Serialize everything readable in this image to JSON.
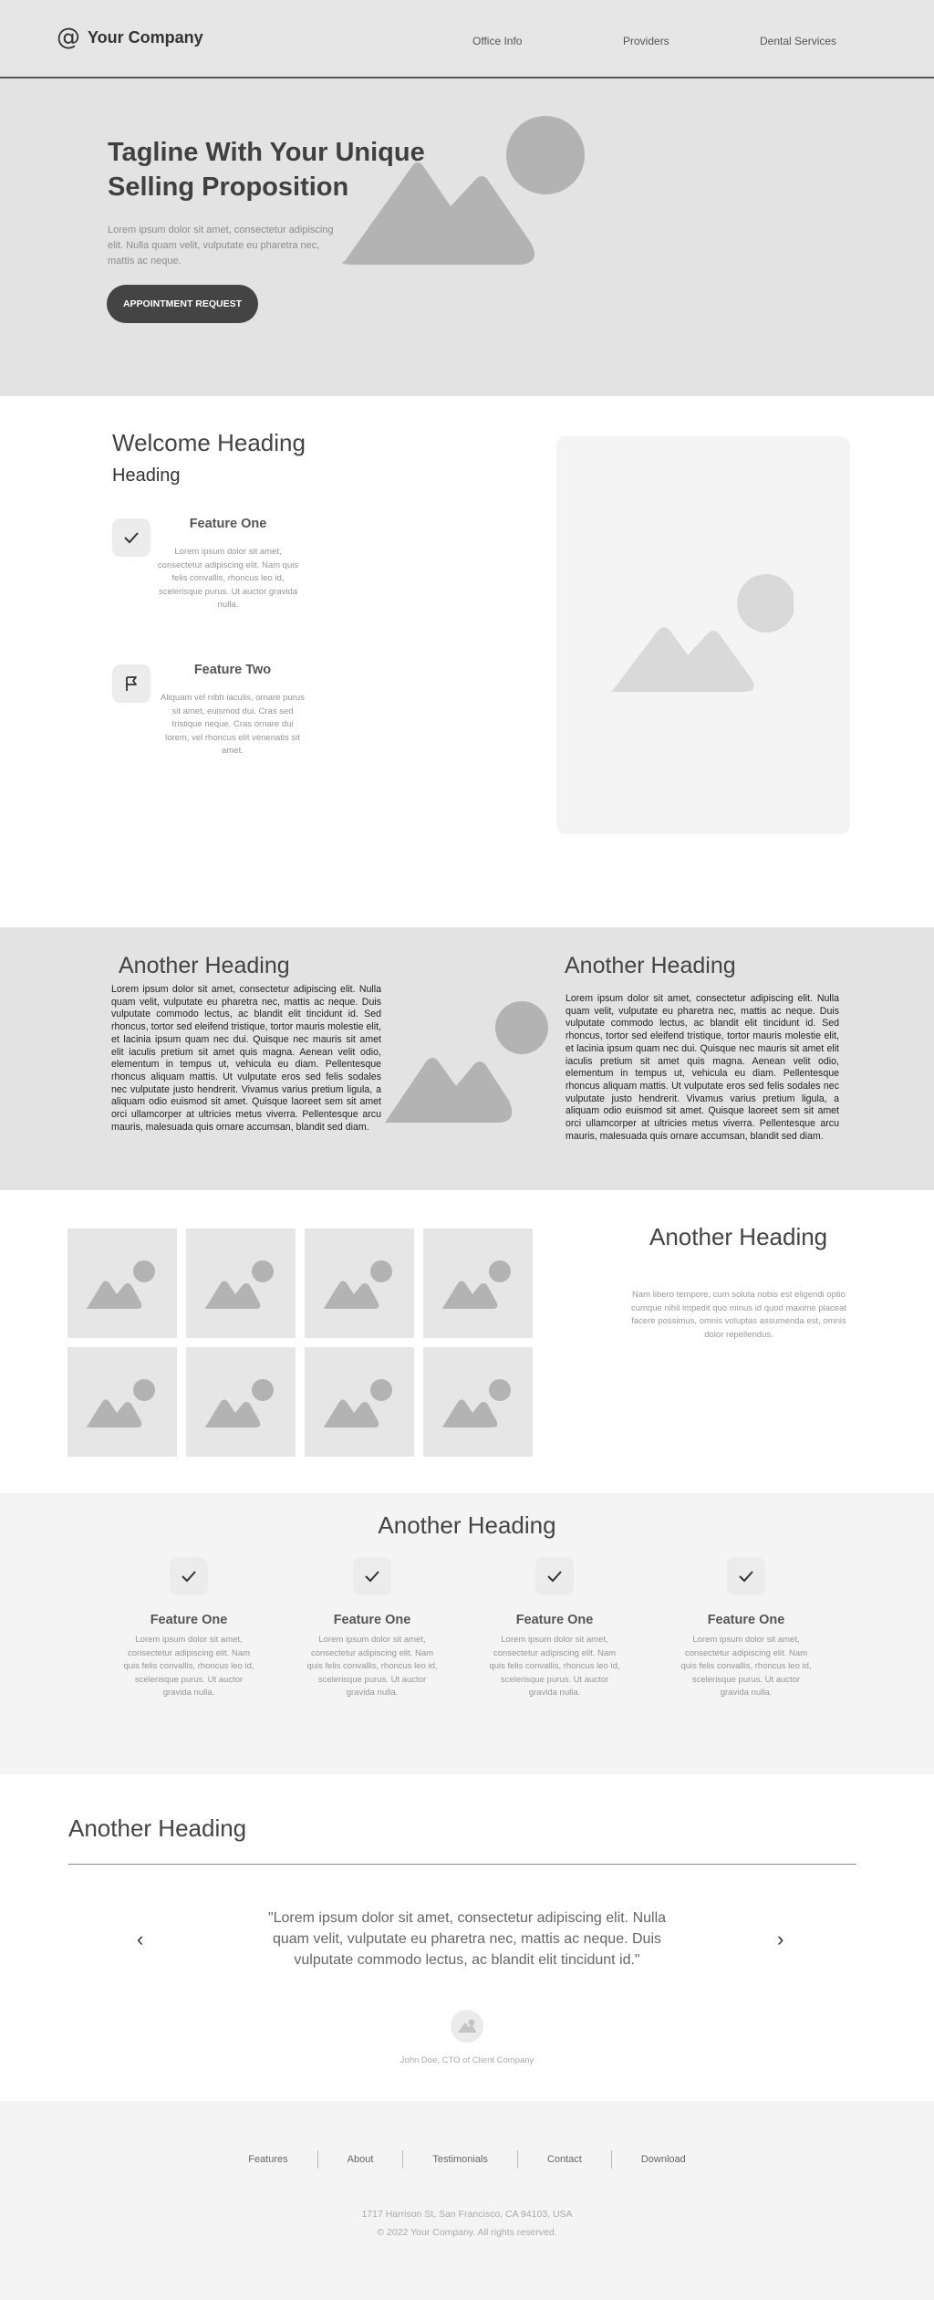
{
  "header": {
    "logo_icon": "@",
    "company": "Your Company",
    "nav": [
      "Office Info",
      "Providers",
      "Dental Services"
    ]
  },
  "hero": {
    "title": "Tagline With Your Unique Selling Proposition",
    "text": "Lorem ipsum dolor sit amet, consectetur adipiscing elit. Nulla quam velit, vulputate eu pharetra nec, mattis ac neque.",
    "button": "APPOINTMENT REQUEST"
  },
  "welcome": {
    "heading": "Welcome Heading",
    "subheading": "Heading",
    "features": [
      {
        "icon": "check-icon",
        "title": "Feature One",
        "text": "Lorem ipsum dolor sit amet, consectetur adipiscing elit. Nam quis felis convallis, rhoncus leo id, scelerisque purus. Ut auctor gravida nulla."
      },
      {
        "icon": "flag-icon",
        "title": "Feature Two",
        "text": "Aliquam vel nibh iaculis, ornare purus sit amet, euismod dui. Cras sed tristique neque. Cras ornare dui lorem, vel rhoncus elit venenatis sit amet."
      }
    ]
  },
  "split": {
    "left_heading": "Another Heading",
    "left_text": "Lorem ipsum dolor sit amet, consectetur adipiscing elit. Nulla quam velit, vulputate eu pharetra nec, mattis ac neque. Duis vulputate commodo lectus, ac blandit elit tincidunt id. Sed rhoncus, tortor sed eleifend tristique, tortor mauris molestie elit, et lacinia ipsum quam nec dui. Quisque nec mauris sit amet elit iaculis pretium sit amet quis magna. Aenean velit odio, elementum in tempus ut, vehicula eu diam. Pellentesque rhoncus aliquam mattis. Ut vulputate eros sed felis sodales nec vulputate justo hendrerit. Vivamus varius pretium ligula, a aliquam odio euismod sit amet. Quisque laoreet sem sit amet orci ullamcorper at ultricies metus viverra. Pellentesque arcu mauris, malesuada quis ornare accumsan, blandit sed diam.",
    "right_heading": "Another Heading",
    "right_text": "Lorem ipsum dolor sit amet, consectetur adipiscing elit. Nulla quam velit, vulputate eu pharetra nec, mattis ac neque. Duis vulputate commodo lectus, ac blandit elit tincidunt id. Sed rhoncus, tortor sed eleifend tristique, tortor mauris molestie elit, et lacinia ipsum quam nec dui. Quisque nec mauris sit amet elit iaculis pretium sit amet quis magna. Aenean velit odio, elementum in tempus ut, vehicula eu diam. Pellentesque rhoncus aliquam mattis. Ut vulputate eros sed felis sodales nec vulputate justo hendrerit. Vivamus varius pretium ligula, a aliquam odio euismod sit amet. Quisque laoreet sem sit amet orci ullamcorper at ultricies metus viverra. Pellentesque arcu mauris, malesuada quis ornare accumsan, blandit sed diam."
  },
  "gallery": {
    "heading": "Another Heading",
    "text": "Nam libero tempore, cum soluta nobis est eligendi optio cumque nihil impedit quo minus id quod maxime placeat facere possimus, omnis voluptas assumenda est, omnis dolor repellendus."
  },
  "features_grid": {
    "heading": "Another Heading",
    "items": [
      {
        "title": "Feature One",
        "text": "Lorem ipsum dolor sit amet, consectetur adipiscing elit. Nam quis felis convallis, rhoncus leo id, scelerisque purus. Ut auctor gravida nulla."
      },
      {
        "title": "Feature One",
        "text": "Lorem ipsum dolor sit amet, consectetur adipiscing elit. Nam quis felis convallis, rhoncus leo id, scelerisque purus. Ut auctor gravida nulla."
      },
      {
        "title": "Feature One",
        "text": "Lorem ipsum dolor sit amet, consectetur adipiscing elit. Nam quis felis convallis, rhoncus leo id, scelerisque purus. Ut auctor gravida nulla."
      },
      {
        "title": "Feature One",
        "text": "Lorem ipsum dolor sit amet, consectetur adipiscing elit. Nam quis felis convallis, rhoncus leo id, scelerisque purus. Ut auctor gravida nulla."
      }
    ]
  },
  "testimonial": {
    "heading": "Another Heading",
    "quote": "\"Lorem ipsum dolor sit amet, consectetur adipiscing elit. Nulla quam velit, vulputate eu pharetra nec, mattis ac neque. Duis vulputate commodo lectus, ac blandit elit tincidunt id.\"",
    "author": "John Doe, CTO of Client Company",
    "prev_icon": "‹",
    "next_icon": "›"
  },
  "footer": {
    "nav": [
      "Features",
      "About",
      "Testimonials",
      "Contact",
      "Download"
    ],
    "address": "1717 Harrison St, San Francisco, CA 94103, USA",
    "copyright": "© 2022 Your Company.  All rights reserved."
  },
  "colors": {
    "header_bg": "#e6e6e6",
    "hero_bg": "#e3e3e3",
    "button_bg": "#444444",
    "placeholder_shape": "#b3b3b3",
    "light_section_bg": "#f5f4f4"
  }
}
